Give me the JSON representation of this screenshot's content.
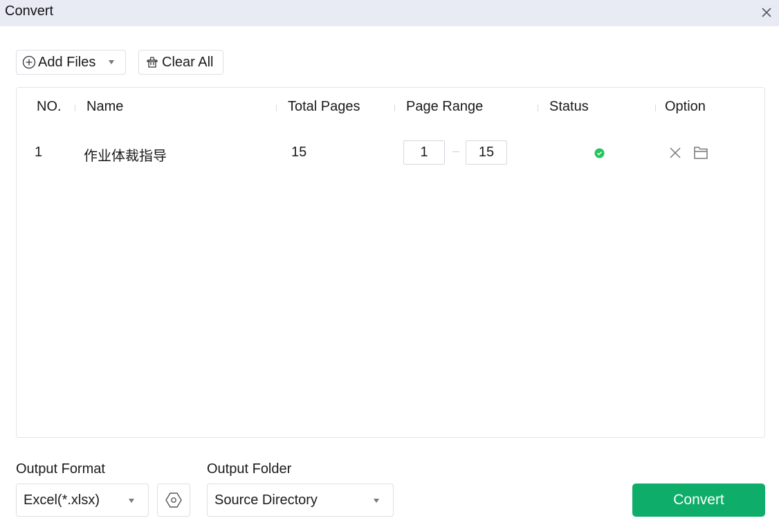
{
  "window": {
    "title": "Convert"
  },
  "toolbar": {
    "add_files_label": "Add Files",
    "clear_all_label": "Clear All"
  },
  "table": {
    "columns": [
      "NO.",
      "Name",
      "Total Pages",
      "Page Range",
      "Status",
      "Option"
    ],
    "rows": [
      {
        "no": "1",
        "name": "作业体裁指导",
        "total_pages": "15",
        "range_from": "1",
        "range_to": "15",
        "status": "success"
      }
    ]
  },
  "output": {
    "format_label": "Output Format",
    "format_value": "Excel(*.xlsx)",
    "folder_label": "Output Folder",
    "folder_value": "Source Directory"
  },
  "actions": {
    "convert_label": "Convert"
  },
  "colors": {
    "accent": "#0fad6a",
    "status_ok": "#22c55e",
    "titlebar": "#e8ebf3"
  }
}
